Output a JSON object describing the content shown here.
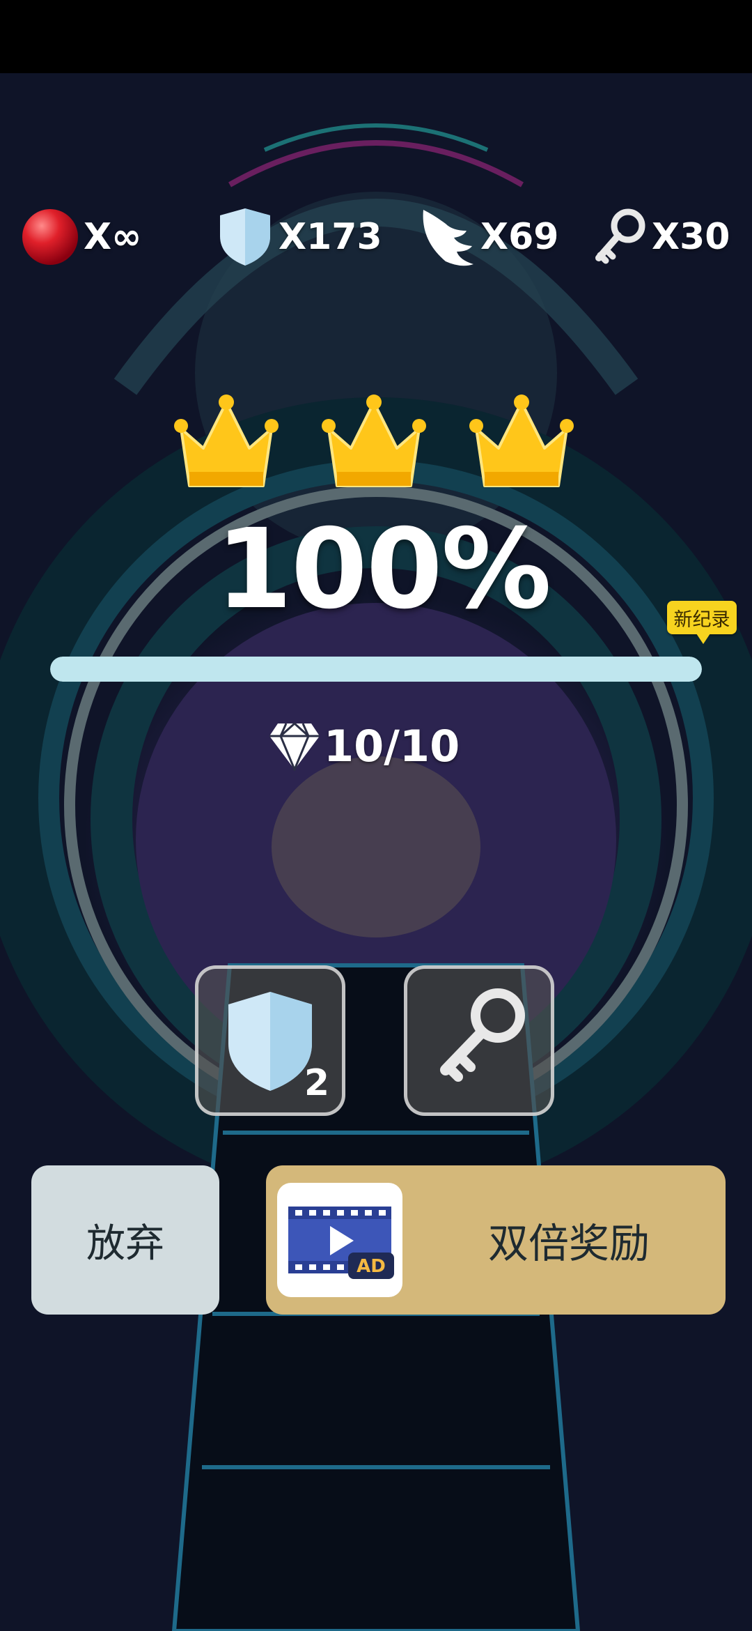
{
  "resources": {
    "lives": "X∞",
    "shields": "X173",
    "wings": "X69",
    "keys": "X30"
  },
  "result": {
    "crowns_earned": 3,
    "crowns_total": 3,
    "percent_text": "100%",
    "progress": 1.0,
    "new_record_label": "新纪录",
    "gems_text": "10/10"
  },
  "items": {
    "shield_count": "2"
  },
  "buttons": {
    "abandon_label": "放弃",
    "double_reward_label": "双倍奖励",
    "ad_badge": "AD"
  },
  "colors": {
    "crown": "#ffc61a",
    "progress_fill": "#bfe6ee",
    "double_button": "#d4b87a",
    "abandon_button": "#d2dcdf",
    "new_record": "#f7d31f"
  }
}
